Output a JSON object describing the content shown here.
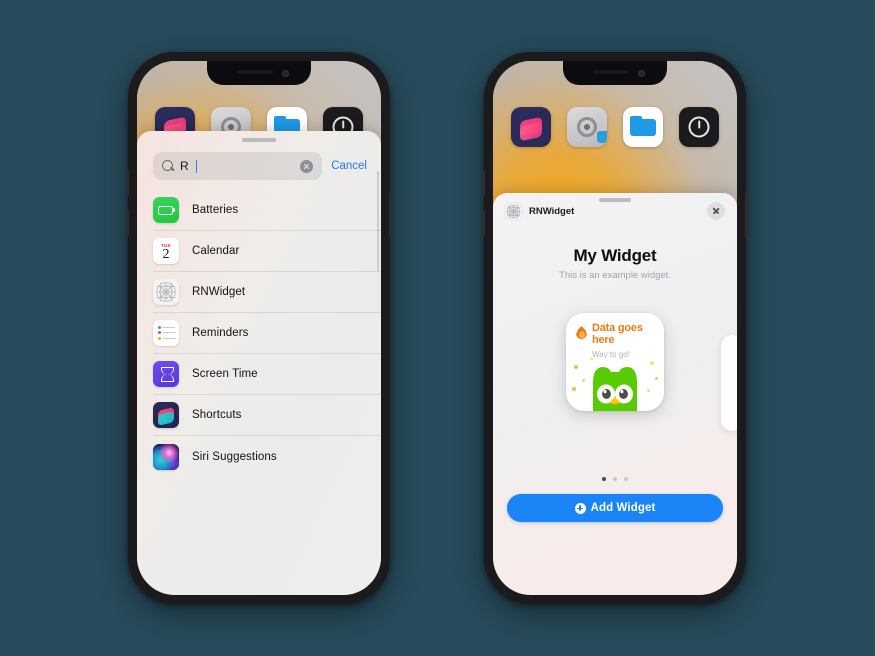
{
  "background_color": "#284c5c",
  "left_phone": {
    "name": "widget-gallery-search-phone",
    "home_screen": {
      "dock_icons": [
        {
          "name": "shortcuts-app-icon",
          "label": "Shortcuts"
        },
        {
          "name": "settings-app-icon",
          "label": "Settings"
        },
        {
          "name": "files-app-icon",
          "label": "Files"
        },
        {
          "name": "clock-app-icon",
          "label": "Clock"
        }
      ]
    },
    "search": {
      "query": "R",
      "icon": "search-icon",
      "clear_icon": "clear-circle-icon",
      "cancel_label": "Cancel",
      "cancel_color": "#1a7cf0"
    },
    "results_list": [
      {
        "label": "Batteries",
        "icon": "batteries-icon"
      },
      {
        "label": "Calendar",
        "icon": "calendar-icon",
        "day_of_week": "TUE",
        "day_number": "2"
      },
      {
        "label": "RNWidget",
        "icon": "rnwidget-grid-icon"
      },
      {
        "label": "Reminders",
        "icon": "reminders-icon"
      },
      {
        "label": "Screen Time",
        "icon": "screen-time-hourglass-icon"
      },
      {
        "label": "Shortcuts",
        "icon": "shortcuts-icon"
      },
      {
        "label": "Siri Suggestions",
        "icon": "siri-orb-icon"
      }
    ]
  },
  "right_phone": {
    "name": "widget-detail-phone",
    "sheet": {
      "app_name": "RNWidget",
      "app_icon": "rnwidget-grid-icon",
      "close_icon": "close-icon",
      "title": "My Widget",
      "subtitle": "This is an example widget.",
      "preview_card": {
        "headline": "Data goes here",
        "subtext": "Way to go!",
        "headline_color": "#ef7b16",
        "flame_icon": "flame-icon",
        "mascot": "owl-mascot"
      },
      "page_dots": {
        "total": 3,
        "active_index": 0
      },
      "add_button": {
        "label": "Add Widget",
        "icon": "plus-circle-icon",
        "color": "#1b84f7"
      }
    }
  }
}
